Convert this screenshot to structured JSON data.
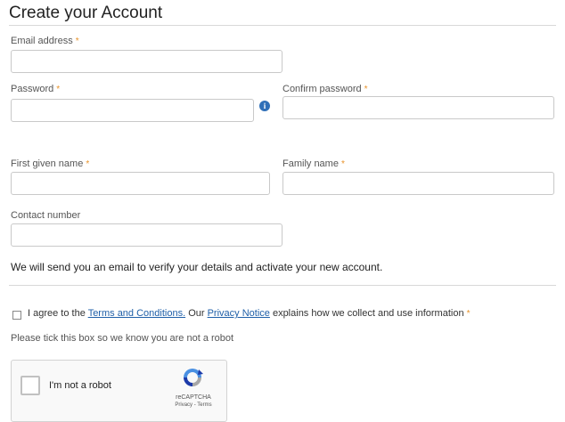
{
  "page_title": "Create your Account",
  "form": {
    "email": {
      "label": "Email address",
      "required_mark": "*",
      "value": "",
      "placeholder": ""
    },
    "password": {
      "label": "Password",
      "required_mark": "*",
      "value": "",
      "placeholder": "",
      "info_icon_glyph": "i"
    },
    "confirm_password": {
      "label": "Confirm password",
      "required_mark": "*",
      "value": "",
      "placeholder": ""
    },
    "first_name": {
      "label": "First given name",
      "required_mark": "*",
      "value": "",
      "placeholder": ""
    },
    "family_name": {
      "label": "Family name",
      "required_mark": "*",
      "value": "",
      "placeholder": ""
    },
    "contact_number": {
      "label": "Contact number",
      "value": "",
      "placeholder": ""
    }
  },
  "verify_notice": "We will send you an email to verify your details and activate your new account.",
  "agreement": {
    "prefix": "I agree to the ",
    "terms_link": "Terms and Conditions.",
    "middle": " Our ",
    "privacy_link": "Privacy Notice",
    "suffix": " explains how we collect and use information",
    "required_mark": "*",
    "checked": false
  },
  "robot_hint": "Please tick this box so we know you are not a robot",
  "recaptcha": {
    "label": "I'm not a robot",
    "brand": "reCAPTCHA",
    "links": "Privacy - Terms"
  },
  "colors": {
    "required": "#e8932a",
    "link": "#1f5fa8",
    "info_icon": "#2f6fb8"
  }
}
